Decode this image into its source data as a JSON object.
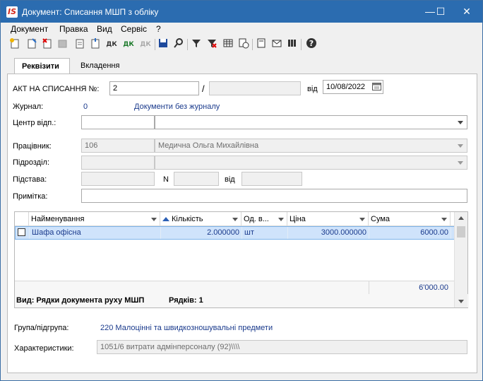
{
  "window": {
    "logo": "IS",
    "title": "Документ: Списання МШП з обліку",
    "minimize": "—",
    "maximize": "☐",
    "close": "✕"
  },
  "menu": [
    "Документ",
    "Правка",
    "Вид",
    "Сервіс",
    "?"
  ],
  "toolbar": {
    "dk1": "ДК",
    "dk2": "ДК",
    "dk3": "ДК"
  },
  "tabs": [
    "Реквізити",
    "Вкладення"
  ],
  "form": {
    "act_label": "АКТ НА СПИСАННЯ №:",
    "act_number": "2",
    "act_suffix": "",
    "slash": "/",
    "date_label": "від",
    "date_value": "10/08/2022",
    "journal_label": "Журнал:",
    "journal_value": "0",
    "journal_name": "Документи без журналу",
    "center_label": "Центр відп.:",
    "center_code": "",
    "center_name": "",
    "worker_label": "Працівник:",
    "worker_code": "106",
    "worker_name": "Медична Ольга Михайлівна",
    "division_label": "Підрозділ:",
    "division_code": "",
    "division_name": "",
    "basis_label": "Підстава:",
    "basis_value": "",
    "n_label": "N",
    "n_value": "",
    "from_label": "від",
    "from_value": "",
    "note_label": "Примітка:",
    "note_value": ""
  },
  "grid": {
    "columns": [
      "Найменування",
      "Кількість",
      "Од. в...",
      "Ціна",
      "Сума"
    ],
    "rows": [
      {
        "name": "Шафа офісна",
        "qty": "2.000000",
        "unit": "шт",
        "price": "3000.000000",
        "sum": "6000.00"
      }
    ],
    "total": "6'000.00",
    "view_label": "Вид: Рядки документа руху МШП",
    "rows_label": "Рядків: 1"
  },
  "bottom": {
    "group_label": "Група/підгрупа:",
    "group_value": "220 Малоцінні та швидкозношувальні предмети",
    "char_label": "Характеристики:",
    "char_value": "1051/6 витрати адмінперсоналу (92)\\\\\\\\"
  }
}
